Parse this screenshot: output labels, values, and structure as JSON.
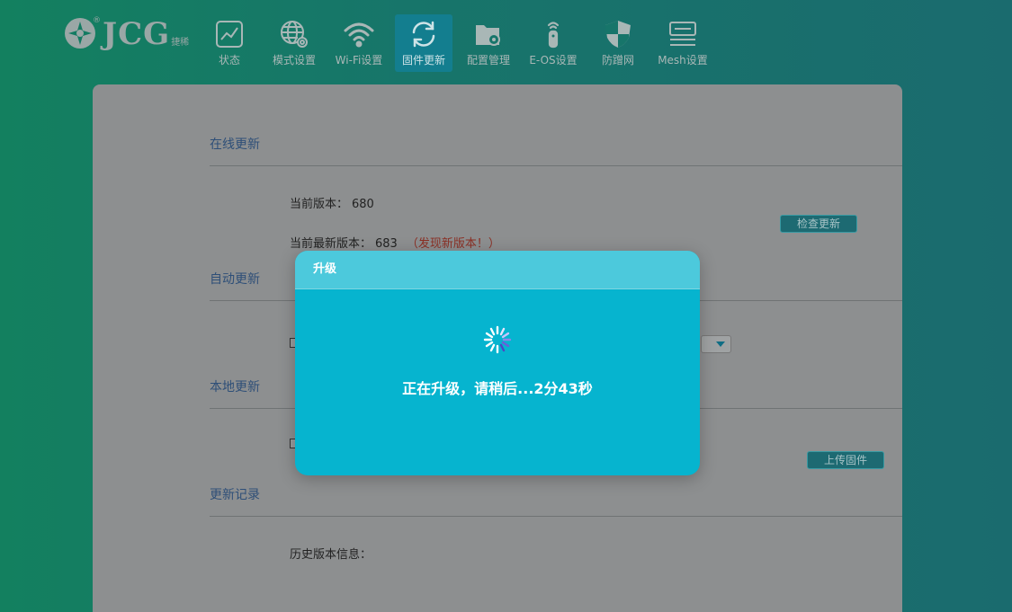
{
  "brand": {
    "name": "JCG",
    "sub": "捷稀",
    "registered": "®"
  },
  "nav": [
    {
      "label": "状态",
      "icon": "chart-icon"
    },
    {
      "label": "模式设置",
      "icon": "globe-gear-icon"
    },
    {
      "label": "Wi-Fi设置",
      "icon": "wifi-icon"
    },
    {
      "label": "固件更新",
      "icon": "refresh-icon",
      "active": true
    },
    {
      "label": "配置管理",
      "icon": "folder-gear-icon"
    },
    {
      "label": "E-OS设置",
      "icon": "antenna-icon"
    },
    {
      "label": "防蹭网",
      "icon": "shield-icon"
    },
    {
      "label": "Mesh设置",
      "icon": "mesh-list-icon"
    }
  ],
  "sections": {
    "online": {
      "title": "在线更新",
      "current_version_label": "当前版本：",
      "current_version": "680",
      "latest_version_label": "当前最新版本：",
      "latest_version": "683",
      "new_version_note": "（发现新版本！）",
      "check_button": "检查更新"
    },
    "auto": {
      "title": "自动更新"
    },
    "local": {
      "title": "本地更新",
      "upload_button": "上传固件"
    },
    "history": {
      "title": "更新记录",
      "history_label": "历史版本信息："
    }
  },
  "modal": {
    "title": "升级",
    "message": "正在升级，请稍后...2分43秒"
  },
  "colors": {
    "modal_bg": "#06b4cf",
    "modal_header": "#4cc9dc",
    "active_tab": "#137e8f",
    "alert_red": "#8b2f24"
  }
}
